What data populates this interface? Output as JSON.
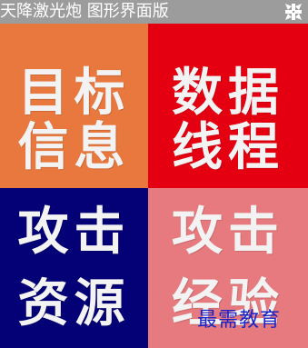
{
  "window": {
    "title": "天降激光炮 图形界面版"
  },
  "tiles": [
    {
      "line1": "目标",
      "line2": "信息",
      "color": "#e9783e"
    },
    {
      "line1": "数据",
      "line2": "线程",
      "color": "#e50011"
    },
    {
      "line1": "攻击",
      "line2": "资源",
      "color": "#040076"
    },
    {
      "line1": "攻击",
      "line2": "经验",
      "color": "#e67a7e"
    }
  ],
  "watermark": "最需教育",
  "icons": {
    "close": "close-icon"
  }
}
